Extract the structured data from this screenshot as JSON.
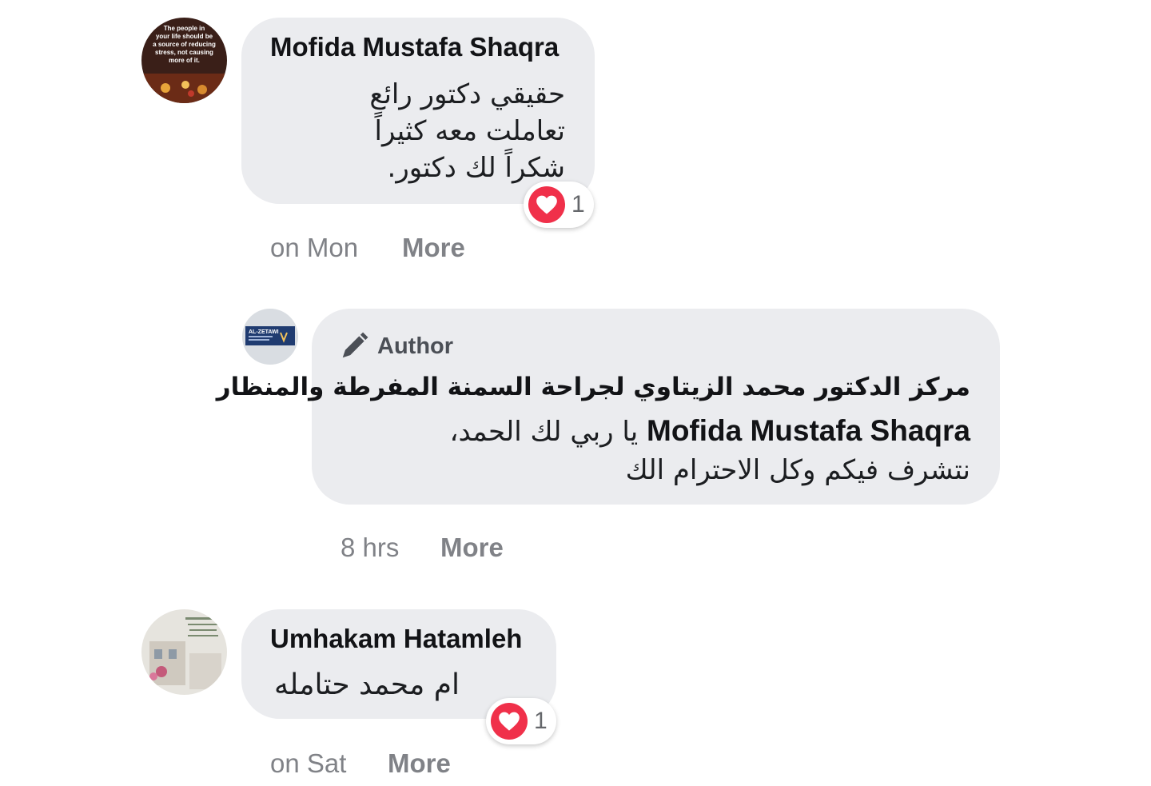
{
  "comments": [
    {
      "author": "Mofida Mustafa Shaqra",
      "text_lines": [
        "حقيقي دكتور رائع",
        "تعاملت معه كثيراً",
        "شكراً لك دكتور."
      ],
      "reaction_count": "1",
      "reaction_icon": "heart-icon",
      "time": "on Mon",
      "more_label": "More",
      "avatar_text": "The people in your life should be a source of reducing stress, not causing more of it."
    },
    {
      "author_badge": "Author",
      "author_badge_icon": "pen-icon",
      "author": "مركز الدكتور محمد الزيتاوي لجراحة السمنة المفرطة والمنظار",
      "mention": "Mofida Mustafa Shaqra",
      "text_after_mention": "يا ربي لك الحمد،",
      "text_last": "نتشرف فيكم وكل الاحترام الك",
      "avatar_text": "AL-ZETAWI",
      "time": "8 hrs",
      "more_label": "More"
    },
    {
      "author": "Umhakam Hatamleh",
      "text_lines": [
        "ام محمد حتامله"
      ],
      "reaction_count": "1",
      "reaction_icon": "heart-icon",
      "time": "on Sat",
      "more_label": "More"
    }
  ],
  "colors": {
    "bubble": "#ebecef",
    "heart": "#f0304a",
    "meta": "#808287"
  }
}
